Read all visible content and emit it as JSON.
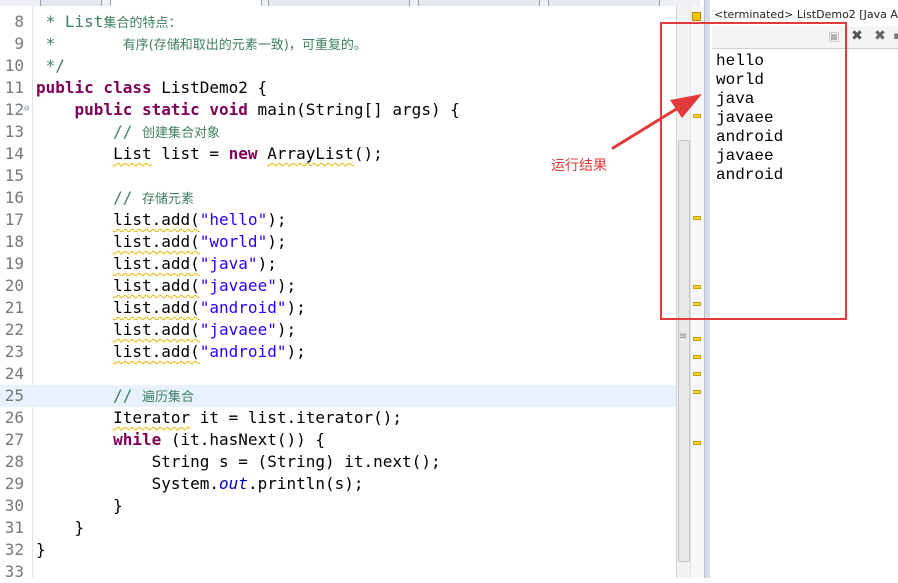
{
  "editor": {
    "lines": [
      {
        "n": "8",
        "segs": [
          {
            "c": "cm",
            "t": " * List"
          },
          {
            "c": "cmj",
            "t": "集合的特点："
          }
        ]
      },
      {
        "n": "9",
        "segs": [
          {
            "c": "cm",
            "t": " *       "
          },
          {
            "c": "cmj",
            "t": "有序(存储和取出的元素一致)，可重复的。"
          }
        ]
      },
      {
        "n": "10",
        "segs": [
          {
            "c": "cm",
            "t": " */"
          }
        ]
      },
      {
        "n": "11",
        "segs": [
          {
            "c": "kw",
            "t": "public class"
          },
          {
            "c": "",
            "t": " ListDemo2 {"
          }
        ]
      },
      {
        "n": "12",
        "fold": true,
        "segs": [
          {
            "c": "",
            "t": "    "
          },
          {
            "c": "kw",
            "t": "public static void"
          },
          {
            "c": "",
            "t": " main(String[] args) {"
          }
        ]
      },
      {
        "n": "13",
        "segs": [
          {
            "c": "cm",
            "t": "        // "
          },
          {
            "c": "cmj",
            "t": "创建集合对象"
          }
        ]
      },
      {
        "n": "14",
        "segs": [
          {
            "c": "",
            "t": "        "
          },
          {
            "c": "sq",
            "t": "List"
          },
          {
            "c": "",
            "t": " list = "
          },
          {
            "c": "kw",
            "t": "new"
          },
          {
            "c": "",
            "t": " "
          },
          {
            "c": "sq",
            "t": "ArrayList"
          },
          {
            "c": "",
            "t": "();"
          }
        ]
      },
      {
        "n": "15",
        "segs": []
      },
      {
        "n": "16",
        "segs": [
          {
            "c": "cm",
            "t": "        // "
          },
          {
            "c": "cmj",
            "t": "存储元素"
          }
        ]
      },
      {
        "n": "17",
        "segs": [
          {
            "c": "",
            "t": "        "
          },
          {
            "c": "sq",
            "t": "list.add("
          },
          {
            "c": "str",
            "t": "\"hello\""
          },
          {
            "c": "",
            "t": ");"
          }
        ]
      },
      {
        "n": "18",
        "segs": [
          {
            "c": "",
            "t": "        "
          },
          {
            "c": "sq",
            "t": "list.add("
          },
          {
            "c": "str",
            "t": "\"world\""
          },
          {
            "c": "",
            "t": ");"
          }
        ]
      },
      {
        "n": "19",
        "segs": [
          {
            "c": "",
            "t": "        "
          },
          {
            "c": "sq",
            "t": "list.add("
          },
          {
            "c": "str",
            "t": "\"java\""
          },
          {
            "c": "",
            "t": ");"
          }
        ]
      },
      {
        "n": "20",
        "segs": [
          {
            "c": "",
            "t": "        "
          },
          {
            "c": "sq",
            "t": "list.add("
          },
          {
            "c": "str",
            "t": "\"javaee\""
          },
          {
            "c": "",
            "t": ");"
          }
        ]
      },
      {
        "n": "21",
        "segs": [
          {
            "c": "",
            "t": "        "
          },
          {
            "c": "sq",
            "t": "list.add("
          },
          {
            "c": "str",
            "t": "\"android\""
          },
          {
            "c": "",
            "t": ");"
          }
        ]
      },
      {
        "n": "22",
        "segs": [
          {
            "c": "",
            "t": "        "
          },
          {
            "c": "sq",
            "t": "list.add("
          },
          {
            "c": "str",
            "t": "\"javaee\""
          },
          {
            "c": "",
            "t": ");"
          }
        ]
      },
      {
        "n": "23",
        "segs": [
          {
            "c": "",
            "t": "        "
          },
          {
            "c": "sq",
            "t": "list.add("
          },
          {
            "c": "str",
            "t": "\"android\""
          },
          {
            "c": "",
            "t": ");"
          }
        ]
      },
      {
        "n": "24",
        "segs": []
      },
      {
        "n": "25",
        "current": true,
        "segs": [
          {
            "c": "cm",
            "t": "        // "
          },
          {
            "c": "cmj",
            "t": "遍历集合"
          }
        ]
      },
      {
        "n": "26",
        "segs": [
          {
            "c": "",
            "t": "        "
          },
          {
            "c": "sq",
            "t": "Iterator"
          },
          {
            "c": "",
            "t": " it = list.iterator();"
          }
        ]
      },
      {
        "n": "27",
        "segs": [
          {
            "c": "",
            "t": "        "
          },
          {
            "c": "kw",
            "t": "while"
          },
          {
            "c": "",
            "t": " (it.hasNext()) {"
          }
        ]
      },
      {
        "n": "28",
        "segs": [
          {
            "c": "",
            "t": "            String s = (String) it.next();"
          }
        ]
      },
      {
        "n": "29",
        "segs": [
          {
            "c": "",
            "t": "            System."
          },
          {
            "c": "fld",
            "t": "out"
          },
          {
            "c": "",
            "t": ".println(s);"
          }
        ]
      },
      {
        "n": "30",
        "segs": [
          {
            "c": "",
            "t": "        }"
          }
        ]
      },
      {
        "n": "31",
        "segs": [
          {
            "c": "",
            "t": "    }"
          }
        ]
      },
      {
        "n": "32",
        "segs": [
          {
            "c": "",
            "t": "}"
          }
        ]
      },
      {
        "n": "33",
        "segs": []
      }
    ]
  },
  "console": {
    "title": "<terminated> ListDemo2 [Java A",
    "toolbar": {
      "clear_icon": "console-view-icon",
      "terminate_icon": "close-x-icon",
      "remove_all_icon": "remove-all-icon"
    },
    "output": [
      "hello",
      "world",
      "java",
      "javaee",
      "android",
      "javaee",
      "android"
    ]
  },
  "annotation": {
    "label": "运行结果",
    "color": "#e23a3a"
  },
  "colors": {
    "keyword": "#7f0055",
    "comment": "#3f7f5f",
    "string": "#2a00ff",
    "field": "#0000c0",
    "current_line": "#e8f2fe"
  }
}
